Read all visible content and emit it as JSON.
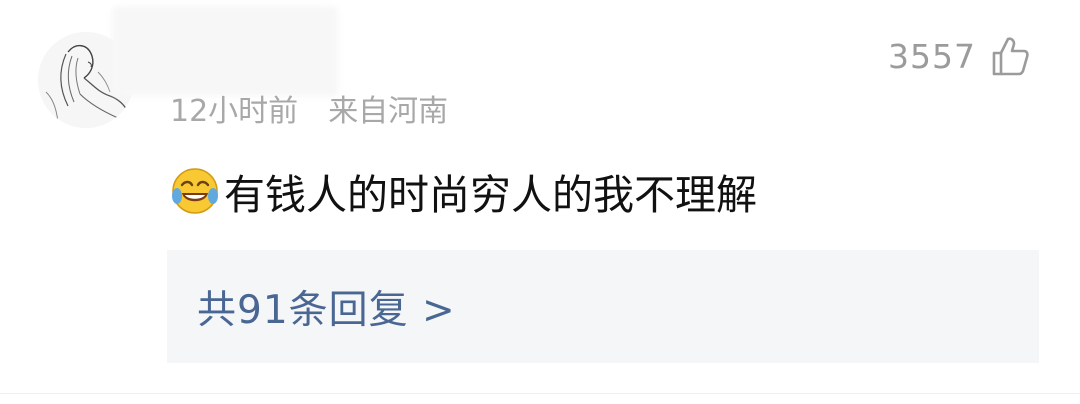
{
  "comment": {
    "time": "12小时前",
    "location": "来自河南",
    "likes": "3557",
    "text": "有钱人的时尚穷人的我不理解",
    "emoji_icon": "laughing-crying-emoji-icon",
    "replies_label": "共91条回复 >"
  },
  "colors": {
    "meta_text": "#a8a8a8",
    "likes_text": "#9b9b9b",
    "body_text": "#111111",
    "reply_link": "#4a6794",
    "reply_bg": "#f5f6f8"
  }
}
